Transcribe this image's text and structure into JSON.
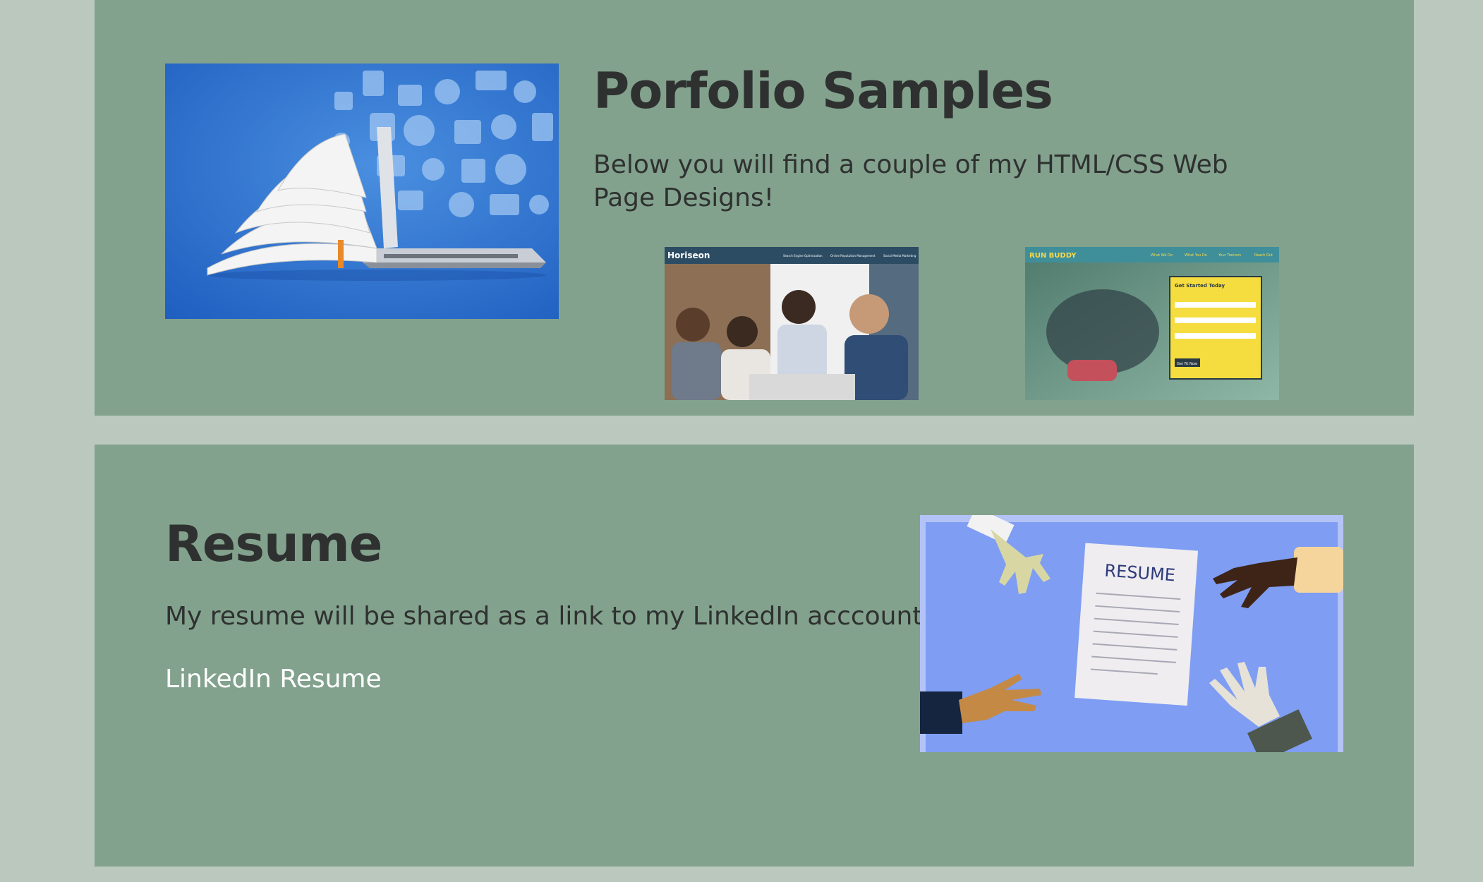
{
  "portfolio": {
    "title": "Porfolio Samples",
    "description": "Below you will find a couple of my HTML/CSS Web Page Designs!",
    "hero_image": "laptop-book-icon-collage",
    "samples": [
      {
        "name": "Horiseon",
        "nav": [
          "Search Engine Optimization",
          "Online Reputation Management",
          "Social Media Marketing"
        ]
      },
      {
        "name": "RUN BUDDY",
        "nav": [
          "What We Do",
          "What You Do",
          "Your Trainers",
          "Reach Out"
        ],
        "form_title": "Get Started Today",
        "form_button": "Get Fit Now"
      }
    ]
  },
  "resume": {
    "title": "Resume",
    "description": "My resume will be shared as a link to my LinkedIn acccount.",
    "link_label": "LinkedIn Resume",
    "image_heading": "RESUME"
  },
  "colors": {
    "page_background": "#bac8be",
    "panel_background": "#82a28e",
    "heading_text": "#2f3130",
    "link_text": "#ffffff"
  }
}
